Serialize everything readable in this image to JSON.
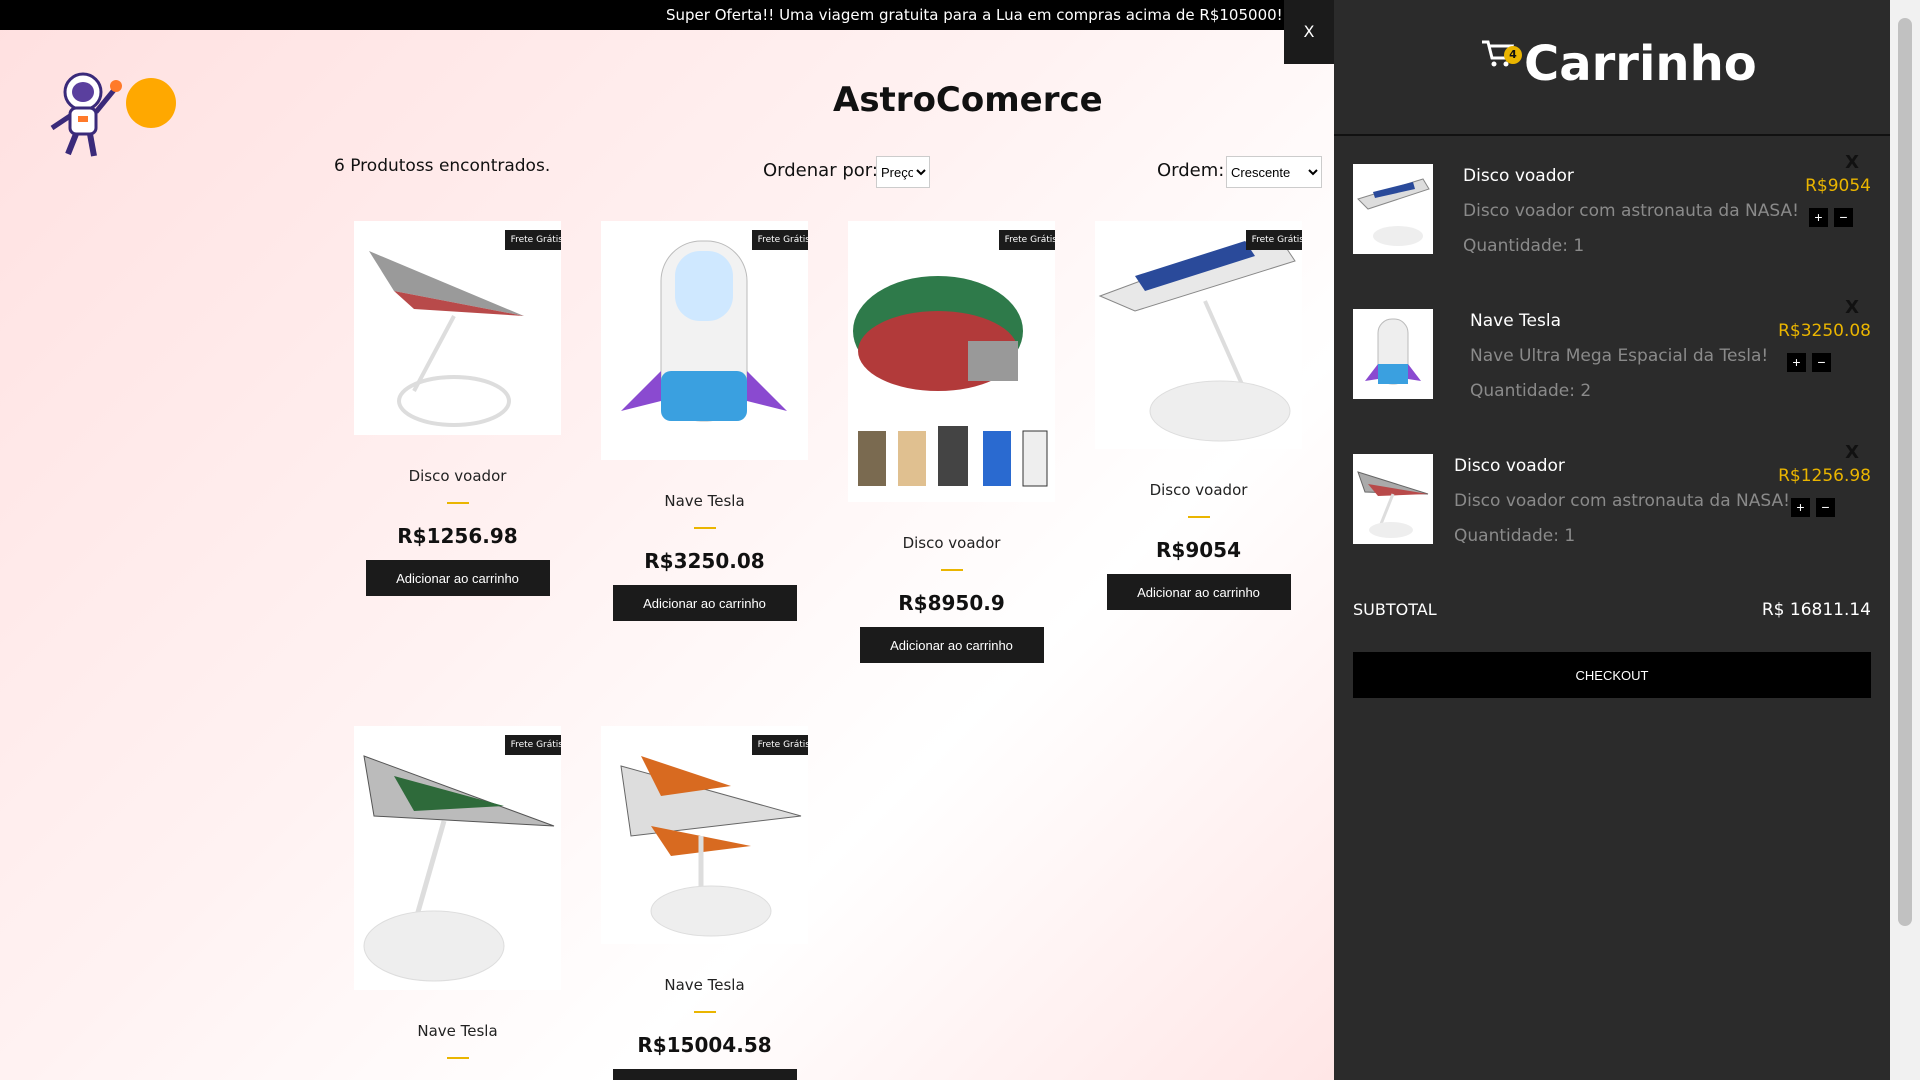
{
  "promo_banner": "Super Oferta!! Uma viagem gratuita para a Lua em compras acima de R$105000!",
  "store_title": "AstroComerce",
  "products_found": "6 Produtoss encontrados.",
  "sort": {
    "label": "Ordenar por:",
    "selected": "Preço"
  },
  "order": {
    "label": "Ordem:",
    "selected": "Crescente"
  },
  "products": [
    {
      "name": "Disco voador",
      "price": "R$1256.98",
      "badge": "Frete Grátis",
      "button": "Adicionar ao carrinho"
    },
    {
      "name": "Nave Tesla",
      "price": "R$3250.08",
      "badge": "Frete Grátis",
      "button": "Adicionar ao carrinho"
    },
    {
      "name": "Disco voador",
      "price": "R$8950.9",
      "badge": "Frete Grátis",
      "button": "Adicionar ao carrinho"
    },
    {
      "name": "Disco voador",
      "price": "R$9054",
      "badge": "Frete Grátis",
      "button": "Adicionar ao carrinho"
    },
    {
      "name": "Nave Tesla",
      "price": "",
      "badge": "Frete Grátis",
      "button": ""
    },
    {
      "name": "Nave Tesla",
      "price": "R$15004.58",
      "badge": "Frete Grátis",
      "button": ""
    }
  ],
  "cart": {
    "close": "X",
    "title": "Carrinho",
    "count": "4",
    "items": [
      {
        "name": "Disco voador",
        "description": "Disco voador com astronauta da NASA!",
        "quantity": "Quantidade: 1",
        "price": "R$9054",
        "remove": "X"
      },
      {
        "name": "Nave Tesla",
        "description": "Nave Ultra Mega Espacial da Tesla!",
        "quantity": "Quantidade: 2",
        "price": "R$3250.08",
        "remove": "X"
      },
      {
        "name": "Disco voador",
        "description": "Disco voador com astronauta da NASA!",
        "quantity": "Quantidade: 1",
        "price": "R$1256.98",
        "remove": "X"
      }
    ],
    "subtotal_label": "SUBTOTAL",
    "subtotal_value": "R$ 16811.14",
    "checkout": "CHECKOUT"
  },
  "colors": {
    "accent": "#eab500",
    "logo_dot": "#ffa800",
    "cart_bg": "#2b2b2b"
  }
}
